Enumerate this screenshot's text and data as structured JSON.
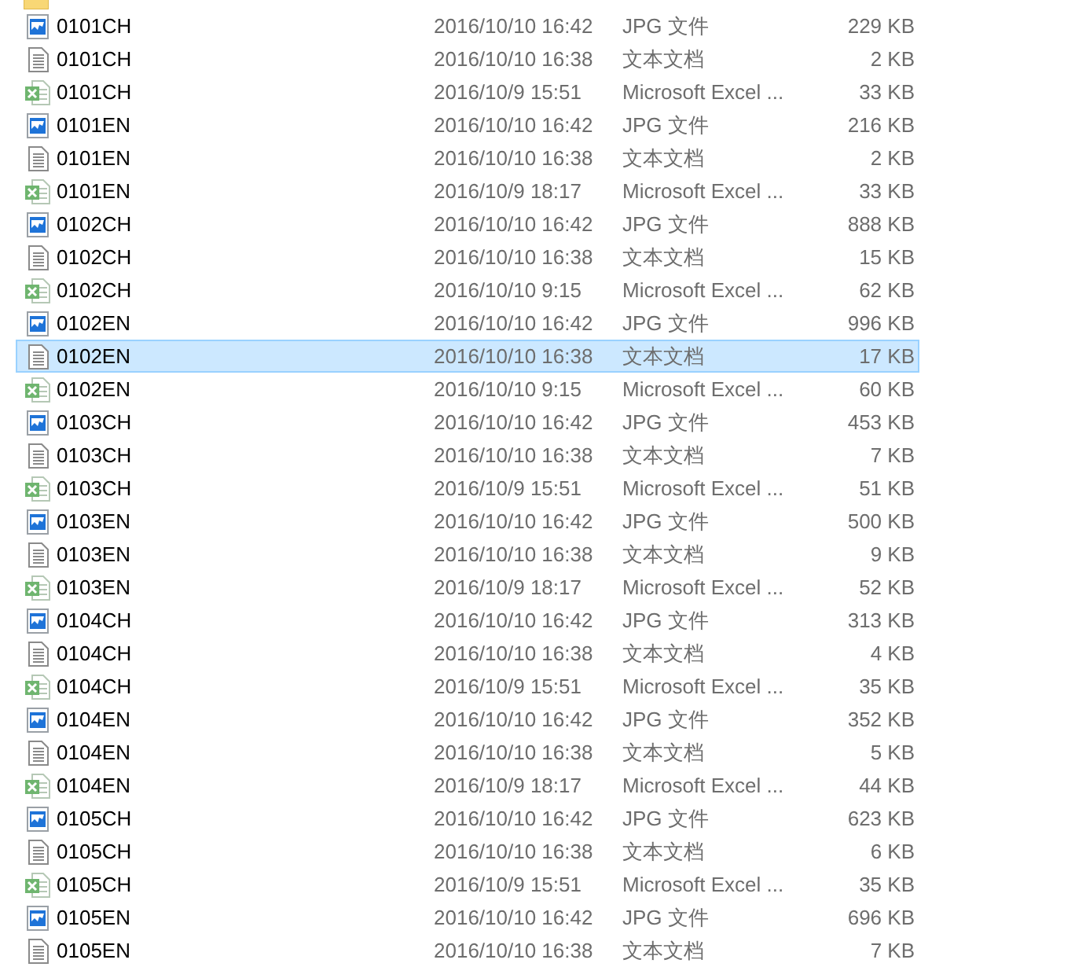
{
  "files": [
    {
      "kind": "folder"
    },
    {
      "kind": "jpg",
      "name": "0101CH",
      "date": "2016/10/10 16:42",
      "type": "JPG 文件",
      "size": "229 KB",
      "selected": false
    },
    {
      "kind": "txt",
      "name": "0101CH",
      "date": "2016/10/10 16:38",
      "type": "文本文档",
      "size": "2 KB",
      "selected": false
    },
    {
      "kind": "xls",
      "name": "0101CH",
      "date": "2016/10/9 15:51",
      "type": "Microsoft Excel ...",
      "size": "33 KB",
      "selected": false
    },
    {
      "kind": "jpg",
      "name": "0101EN",
      "date": "2016/10/10 16:42",
      "type": "JPG 文件",
      "size": "216 KB",
      "selected": false
    },
    {
      "kind": "txt",
      "name": "0101EN",
      "date": "2016/10/10 16:38",
      "type": "文本文档",
      "size": "2 KB",
      "selected": false
    },
    {
      "kind": "xls",
      "name": "0101EN",
      "date": "2016/10/9 18:17",
      "type": "Microsoft Excel ...",
      "size": "33 KB",
      "selected": false
    },
    {
      "kind": "jpg",
      "name": "0102CH",
      "date": "2016/10/10 16:42",
      "type": "JPG 文件",
      "size": "888 KB",
      "selected": false
    },
    {
      "kind": "txt",
      "name": "0102CH",
      "date": "2016/10/10 16:38",
      "type": "文本文档",
      "size": "15 KB",
      "selected": false
    },
    {
      "kind": "xls",
      "name": "0102CH",
      "date": "2016/10/10 9:15",
      "type": "Microsoft Excel ...",
      "size": "62 KB",
      "selected": false
    },
    {
      "kind": "jpg",
      "name": "0102EN",
      "date": "2016/10/10 16:42",
      "type": "JPG 文件",
      "size": "996 KB",
      "selected": false
    },
    {
      "kind": "txt",
      "name": "0102EN",
      "date": "2016/10/10 16:38",
      "type": "文本文档",
      "size": "17 KB",
      "selected": true
    },
    {
      "kind": "xls",
      "name": "0102EN",
      "date": "2016/10/10 9:15",
      "type": "Microsoft Excel ...",
      "size": "60 KB",
      "selected": false
    },
    {
      "kind": "jpg",
      "name": "0103CH",
      "date": "2016/10/10 16:42",
      "type": "JPG 文件",
      "size": "453 KB",
      "selected": false
    },
    {
      "kind": "txt",
      "name": "0103CH",
      "date": "2016/10/10 16:38",
      "type": "文本文档",
      "size": "7 KB",
      "selected": false
    },
    {
      "kind": "xls",
      "name": "0103CH",
      "date": "2016/10/9 15:51",
      "type": "Microsoft Excel ...",
      "size": "51 KB",
      "selected": false
    },
    {
      "kind": "jpg",
      "name": "0103EN",
      "date": "2016/10/10 16:42",
      "type": "JPG 文件",
      "size": "500 KB",
      "selected": false
    },
    {
      "kind": "txt",
      "name": "0103EN",
      "date": "2016/10/10 16:38",
      "type": "文本文档",
      "size": "9 KB",
      "selected": false
    },
    {
      "kind": "xls",
      "name": "0103EN",
      "date": "2016/10/9 18:17",
      "type": "Microsoft Excel ...",
      "size": "52 KB",
      "selected": false
    },
    {
      "kind": "jpg",
      "name": "0104CH",
      "date": "2016/10/10 16:42",
      "type": "JPG 文件",
      "size": "313 KB",
      "selected": false
    },
    {
      "kind": "txt",
      "name": "0104CH",
      "date": "2016/10/10 16:38",
      "type": "文本文档",
      "size": "4 KB",
      "selected": false
    },
    {
      "kind": "xls",
      "name": "0104CH",
      "date": "2016/10/9 15:51",
      "type": "Microsoft Excel ...",
      "size": "35 KB",
      "selected": false
    },
    {
      "kind": "jpg",
      "name": "0104EN",
      "date": "2016/10/10 16:42",
      "type": "JPG 文件",
      "size": "352 KB",
      "selected": false
    },
    {
      "kind": "txt",
      "name": "0104EN",
      "date": "2016/10/10 16:38",
      "type": "文本文档",
      "size": "5 KB",
      "selected": false
    },
    {
      "kind": "xls",
      "name": "0104EN",
      "date": "2016/10/9 18:17",
      "type": "Microsoft Excel ...",
      "size": "44 KB",
      "selected": false
    },
    {
      "kind": "jpg",
      "name": "0105CH",
      "date": "2016/10/10 16:42",
      "type": "JPG 文件",
      "size": "623 KB",
      "selected": false
    },
    {
      "kind": "txt",
      "name": "0105CH",
      "date": "2016/10/10 16:38",
      "type": "文本文档",
      "size": "6 KB",
      "selected": false
    },
    {
      "kind": "xls",
      "name": "0105CH",
      "date": "2016/10/9 15:51",
      "type": "Microsoft Excel ...",
      "size": "35 KB",
      "selected": false
    },
    {
      "kind": "jpg",
      "name": "0105EN",
      "date": "2016/10/10 16:42",
      "type": "JPG 文件",
      "size": "696 KB",
      "selected": false
    },
    {
      "kind": "txt",
      "name": "0105EN",
      "date": "2016/10/10 16:38",
      "type": "文本文档",
      "size": "7 KB",
      "selected": false
    }
  ]
}
